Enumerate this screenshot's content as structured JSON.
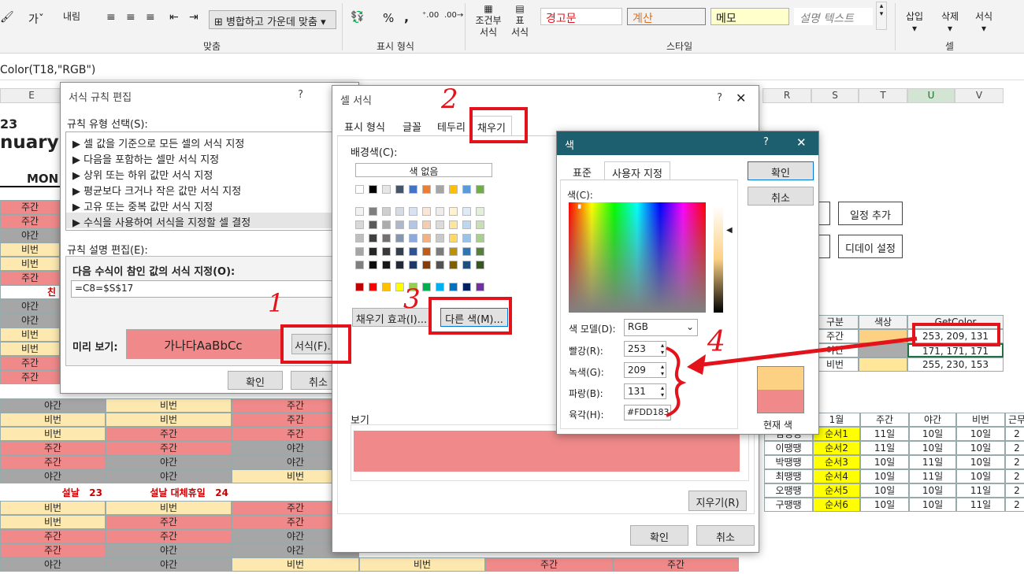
{
  "ribbon": {
    "align_label": "맞춤",
    "merge_label": "병합하고 가운데 맞춤",
    "number_label": "표시 형식",
    "styles_label": "스타일",
    "cells_label": "셀",
    "wrap_label": "내림",
    "percent": "%",
    "comma": ",",
    "conditional": "조건부\n서식",
    "conditional_l1": "조건부",
    "conditional_l2": "서식",
    "table_l1": "표",
    "table_l2": "서식",
    "style_warning": "경고문",
    "style_calc": "계산",
    "style_memo": "메모",
    "style_explain": "설명 텍스트",
    "insert": "삽입",
    "delete": "삭제",
    "format": "서식"
  },
  "formula": {
    "text": "Color(T18,\"RGB\")"
  },
  "sheet": {
    "col_e": "E",
    "year": "23",
    "month": "nuary",
    "mon": "MON",
    "cols_right": [
      "R",
      "S",
      "T",
      "U",
      "V"
    ],
    "left_rows": [
      "주간",
      "주간",
      "야간",
      "비번",
      "비번",
      "주간",
      "",
      "야간",
      "야간",
      "비번",
      "비번",
      "주간",
      "주간"
    ],
    "chin": "친",
    "grid_rows": [
      [
        "야간",
        "비번",
        "주간"
      ],
      [
        "비번",
        "비번",
        "주간"
      ],
      [
        "비번",
        "주간",
        "주간"
      ],
      [
        "주간",
        "주간",
        "야간"
      ],
      [
        "주간",
        "야간",
        "야간"
      ],
      [
        "야간",
        "야간",
        "비번"
      ]
    ],
    "holiday1": "설날",
    "holiday1_day": "23",
    "holiday2": "설날 대체휴일",
    "holiday2_day": "24",
    "grid_rows2": [
      [
        "비번",
        "비번",
        "주간"
      ],
      [
        "비번",
        "주간",
        "주간"
      ],
      [
        "주간",
        "주간",
        "야간"
      ],
      [
        "주간",
        "야간",
        "야간"
      ],
      [
        "야간",
        "야간",
        "비번",
        "비번",
        "주간",
        "주간"
      ]
    ],
    "btn_add": "일정 추가",
    "btn_dday": "디데이 설정",
    "table1_headers": [
      "구분",
      "색상",
      "GetColor"
    ],
    "table1_rows": [
      [
        "주간",
        "253, 209, 131"
      ],
      [
        "야간",
        "171, 171, 171"
      ],
      [
        "비번",
        "255, 230, 153"
      ]
    ],
    "table2_headers": [
      "1월",
      "주간",
      "야간",
      "비번",
      "근무"
    ],
    "table2_rows": [
      [
        "김땡땡",
        "순서1",
        "11일",
        "10일",
        "10일",
        "2"
      ],
      [
        "이땡땡",
        "순서2",
        "11일",
        "10일",
        "10일",
        "2"
      ],
      [
        "박땡땡",
        "순서3",
        "10일",
        "11일",
        "10일",
        "2"
      ],
      [
        "최땡땡",
        "순서4",
        "10일",
        "11일",
        "10일",
        "2"
      ],
      [
        "오땡땡",
        "순서5",
        "10일",
        "10일",
        "11일",
        "2"
      ],
      [
        "구땡땡",
        "순서6",
        "10일",
        "10일",
        "11일",
        "2"
      ]
    ]
  },
  "rule_dialog": {
    "title": "서식 규칙 편집",
    "help": "?",
    "select_type_label": "규칙 유형 선택(S):",
    "types": [
      "▶ 셀 값을 기준으로 모든 셀의 서식 지정",
      "▶ 다음을 포함하는 셀만 서식 지정",
      "▶ 상위 또는 하위 값만 서식 지정",
      "▶ 평균보다 크거나 작은 값만 서식 지정",
      "▶ 고유 또는 중복 값만 서식 지정",
      "▶ 수식을 사용하여 서식을 지정할 셀 결정"
    ],
    "edit_label": "규칙 설명 편집(E):",
    "formula_label": "다음 수식이 참인 값의 서식 지정(O):",
    "formula_value": "=C8=$S$17",
    "preview_label": "미리 보기:",
    "preview_text": "가나다AaBbCc",
    "format_button": "서식(F)...",
    "ok": "확인",
    "cancel": "취소"
  },
  "cell_dialog": {
    "title": "셀 서식",
    "help": "?",
    "tabs": [
      "표시 형식",
      "글꼴",
      "테두리",
      "채우기"
    ],
    "bg_label": "배경색(C):",
    "no_color": "색 없음",
    "fill_effects": "채우기 효과(I)...",
    "more_colors": "다른 색(M)...",
    "preview_label": "보기",
    "clear": "지우기(R)",
    "ok": "확인",
    "cancel": "취소",
    "theme_row": [
      "#ffffff",
      "#000000",
      "#e7e6e6",
      "#44546a",
      "#4472c4",
      "#ed7d31",
      "#a5a5a5",
      "#ffc000",
      "#5b9bd5",
      "#70ad47"
    ],
    "shade_rows": [
      [
        "#f2f2f2",
        "#7f7f7f",
        "#d0cece",
        "#d6dce4",
        "#d9e2f3",
        "#fbe5d5",
        "#ededed",
        "#fff2cc",
        "#deebf6",
        "#e2efd9"
      ],
      [
        "#d8d8d8",
        "#595959",
        "#aeabab",
        "#adb9ca",
        "#b4c6e7",
        "#f7cbac",
        "#dbdbdb",
        "#fee599",
        "#bdd7ee",
        "#c5e0b3"
      ],
      [
        "#bfbfbf",
        "#3f3f3f",
        "#757070",
        "#8496b0",
        "#8eaadb",
        "#f4b183",
        "#c9c9c9",
        "#ffd965",
        "#9cc3e5",
        "#a8d08d"
      ],
      [
        "#a5a5a5",
        "#262626",
        "#3a3838",
        "#323f4f",
        "#2f5496",
        "#c55a11",
        "#7b7b7b",
        "#bf9000",
        "#2e75b5",
        "#538135"
      ],
      [
        "#7f7f7f",
        "#0c0c0c",
        "#171616",
        "#222a35",
        "#1f3864",
        "#833c0b",
        "#525252",
        "#7f6000",
        "#1e4e79",
        "#375623"
      ]
    ],
    "standard_row": [
      "#c00000",
      "#ff0000",
      "#ffc000",
      "#ffff00",
      "#92d050",
      "#00b050",
      "#00b0f0",
      "#0070c0",
      "#002060",
      "#7030a0"
    ],
    "preview_color": "#f08a8a"
  },
  "color_dialog": {
    "title": "색",
    "help": "?",
    "close": "✕",
    "tabs": [
      "표준",
      "사용자 지정"
    ],
    "colors_label": "색(C):",
    "model_label": "색 모델(D):",
    "model_value": "RGB",
    "red_label": "빨강(R):",
    "red_value": "253",
    "green_label": "녹색(G):",
    "green_value": "209",
    "blue_label": "파랑(B):",
    "blue_value": "131",
    "hex_label": "육각(H):",
    "hex_value": "#FDD183",
    "ok": "확인",
    "cancel": "취소",
    "new_color": "#fdd183",
    "current_color": "#f08a8a",
    "current_label": "현재 색"
  },
  "annotations": {
    "n1": "1",
    "n2": "2",
    "n3": "3",
    "n4": "4"
  },
  "colors": {
    "red_cell": "#f08a8a",
    "yellow_cell": "#fde9b0",
    "gray_cell": "#a6a6a6",
    "annot": "#e3131b",
    "accent": "#2f6db5"
  }
}
